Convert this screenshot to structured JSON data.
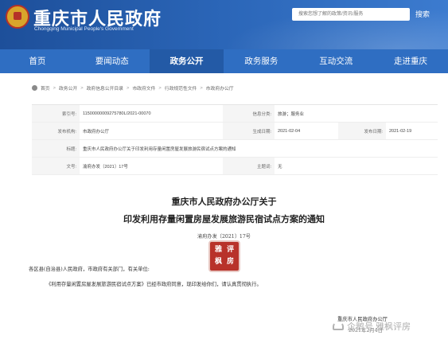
{
  "header": {
    "title": "重庆市人民政府",
    "subtitle": "Chongqing Municipal People's Government",
    "search_placeholder": "搜索您想了解的政策/资讯/服务",
    "search_label": "搜索"
  },
  "nav": {
    "items": [
      "首页",
      "要闻动态",
      "政务公开",
      "政务服务",
      "互动交流",
      "走进重庆"
    ],
    "active_index": 2
  },
  "breadcrumb": [
    "首页",
    "政务公开",
    "政府信息公开目录",
    "市政府文件",
    "行政规范性文件",
    "市政府办公厅"
  ],
  "meta": {
    "index_label": "索引号:",
    "index_value": "11500000009275780L/2021-00070",
    "category_label": "信息分类:",
    "category_value": "旅游；服务业",
    "issuer_label": "发布机构:",
    "issuer_value": "市政府办公厅",
    "created_label": "生成日期:",
    "created_value": "2021-02-04",
    "published_label": "发布日期:",
    "published_value": "2021-02-19",
    "title_label": "标题:",
    "title_value": "重庆市人民政府办公厅关于印发利用存量闲置房屋发展旅游民宿试点方案的通知",
    "docno_label": "文号:",
    "docno_value": "渝府办发〔2021〕17号",
    "subject_label": "主题词:",
    "subject_value": "无"
  },
  "document": {
    "title_line1": "重庆市人民政府办公厅关于",
    "title_line2": "印发利用存量闲置房屋发展旅游民宿试点方案的通知",
    "doc_number": "渝府办发〔2021〕17号",
    "salutation": "各区县(自治县)人民政府，市政府有关部门，有关单位:",
    "paragraph": "《利用存量闲置房屋发展旅游民宿试点方案》已经市政府同意，现印发给你们，请认真贯彻执行。",
    "signature_org": "重庆市人民政府办公厅",
    "signature_date": "2021年2月4日"
  },
  "seal": {
    "chars": [
      "雅",
      "评",
      "枫",
      "房"
    ],
    "color": "#b8322a"
  },
  "watermark": {
    "text": "企鹅号 雅枫评房",
    "icon": "penguin-icon"
  },
  "colors": {
    "header_blue": "#2b66b8",
    "nav_blue": "#2f6ec2",
    "nav_active": "#235aa6"
  }
}
